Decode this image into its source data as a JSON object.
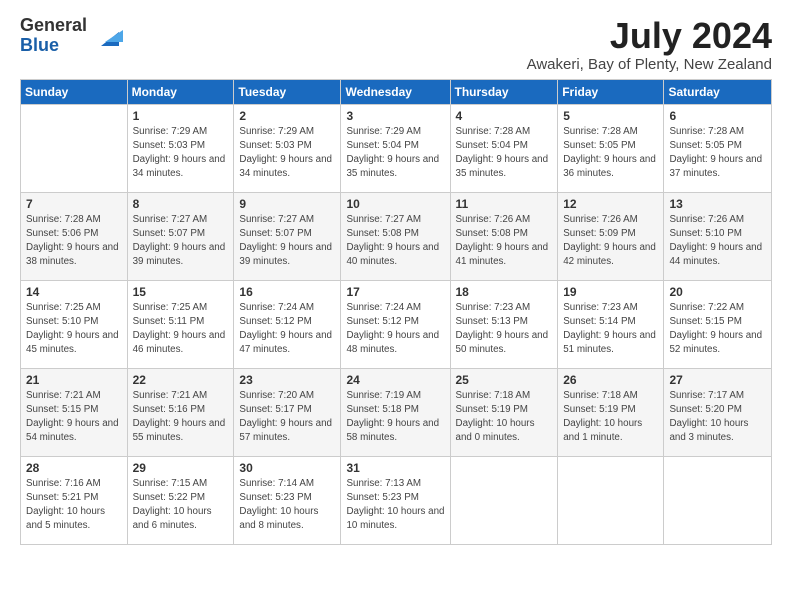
{
  "logo": {
    "general": "General",
    "blue": "Blue"
  },
  "title": "July 2024",
  "location": "Awakeri, Bay of Plenty, New Zealand",
  "weekdays": [
    "Sunday",
    "Monday",
    "Tuesday",
    "Wednesday",
    "Thursday",
    "Friday",
    "Saturday"
  ],
  "weeks": [
    [
      {
        "day": "",
        "sunrise": "",
        "sunset": "",
        "daylight": ""
      },
      {
        "day": "1",
        "sunrise": "Sunrise: 7:29 AM",
        "sunset": "Sunset: 5:03 PM",
        "daylight": "Daylight: 9 hours and 34 minutes."
      },
      {
        "day": "2",
        "sunrise": "Sunrise: 7:29 AM",
        "sunset": "Sunset: 5:03 PM",
        "daylight": "Daylight: 9 hours and 34 minutes."
      },
      {
        "day": "3",
        "sunrise": "Sunrise: 7:29 AM",
        "sunset": "Sunset: 5:04 PM",
        "daylight": "Daylight: 9 hours and 35 minutes."
      },
      {
        "day": "4",
        "sunrise": "Sunrise: 7:28 AM",
        "sunset": "Sunset: 5:04 PM",
        "daylight": "Daylight: 9 hours and 35 minutes."
      },
      {
        "day": "5",
        "sunrise": "Sunrise: 7:28 AM",
        "sunset": "Sunset: 5:05 PM",
        "daylight": "Daylight: 9 hours and 36 minutes."
      },
      {
        "day": "6",
        "sunrise": "Sunrise: 7:28 AM",
        "sunset": "Sunset: 5:05 PM",
        "daylight": "Daylight: 9 hours and 37 minutes."
      }
    ],
    [
      {
        "day": "7",
        "sunrise": "Sunrise: 7:28 AM",
        "sunset": "Sunset: 5:06 PM",
        "daylight": "Daylight: 9 hours and 38 minutes."
      },
      {
        "day": "8",
        "sunrise": "Sunrise: 7:27 AM",
        "sunset": "Sunset: 5:07 PM",
        "daylight": "Daylight: 9 hours and 39 minutes."
      },
      {
        "day": "9",
        "sunrise": "Sunrise: 7:27 AM",
        "sunset": "Sunset: 5:07 PM",
        "daylight": "Daylight: 9 hours and 39 minutes."
      },
      {
        "day": "10",
        "sunrise": "Sunrise: 7:27 AM",
        "sunset": "Sunset: 5:08 PM",
        "daylight": "Daylight: 9 hours and 40 minutes."
      },
      {
        "day": "11",
        "sunrise": "Sunrise: 7:26 AM",
        "sunset": "Sunset: 5:08 PM",
        "daylight": "Daylight: 9 hours and 41 minutes."
      },
      {
        "day": "12",
        "sunrise": "Sunrise: 7:26 AM",
        "sunset": "Sunset: 5:09 PM",
        "daylight": "Daylight: 9 hours and 42 minutes."
      },
      {
        "day": "13",
        "sunrise": "Sunrise: 7:26 AM",
        "sunset": "Sunset: 5:10 PM",
        "daylight": "Daylight: 9 hours and 44 minutes."
      }
    ],
    [
      {
        "day": "14",
        "sunrise": "Sunrise: 7:25 AM",
        "sunset": "Sunset: 5:10 PM",
        "daylight": "Daylight: 9 hours and 45 minutes."
      },
      {
        "day": "15",
        "sunrise": "Sunrise: 7:25 AM",
        "sunset": "Sunset: 5:11 PM",
        "daylight": "Daylight: 9 hours and 46 minutes."
      },
      {
        "day": "16",
        "sunrise": "Sunrise: 7:24 AM",
        "sunset": "Sunset: 5:12 PM",
        "daylight": "Daylight: 9 hours and 47 minutes."
      },
      {
        "day": "17",
        "sunrise": "Sunrise: 7:24 AM",
        "sunset": "Sunset: 5:12 PM",
        "daylight": "Daylight: 9 hours and 48 minutes."
      },
      {
        "day": "18",
        "sunrise": "Sunrise: 7:23 AM",
        "sunset": "Sunset: 5:13 PM",
        "daylight": "Daylight: 9 hours and 50 minutes."
      },
      {
        "day": "19",
        "sunrise": "Sunrise: 7:23 AM",
        "sunset": "Sunset: 5:14 PM",
        "daylight": "Daylight: 9 hours and 51 minutes."
      },
      {
        "day": "20",
        "sunrise": "Sunrise: 7:22 AM",
        "sunset": "Sunset: 5:15 PM",
        "daylight": "Daylight: 9 hours and 52 minutes."
      }
    ],
    [
      {
        "day": "21",
        "sunrise": "Sunrise: 7:21 AM",
        "sunset": "Sunset: 5:15 PM",
        "daylight": "Daylight: 9 hours and 54 minutes."
      },
      {
        "day": "22",
        "sunrise": "Sunrise: 7:21 AM",
        "sunset": "Sunset: 5:16 PM",
        "daylight": "Daylight: 9 hours and 55 minutes."
      },
      {
        "day": "23",
        "sunrise": "Sunrise: 7:20 AM",
        "sunset": "Sunset: 5:17 PM",
        "daylight": "Daylight: 9 hours and 57 minutes."
      },
      {
        "day": "24",
        "sunrise": "Sunrise: 7:19 AM",
        "sunset": "Sunset: 5:18 PM",
        "daylight": "Daylight: 9 hours and 58 minutes."
      },
      {
        "day": "25",
        "sunrise": "Sunrise: 7:18 AM",
        "sunset": "Sunset: 5:19 PM",
        "daylight": "Daylight: 10 hours and 0 minutes."
      },
      {
        "day": "26",
        "sunrise": "Sunrise: 7:18 AM",
        "sunset": "Sunset: 5:19 PM",
        "daylight": "Daylight: 10 hours and 1 minute."
      },
      {
        "day": "27",
        "sunrise": "Sunrise: 7:17 AM",
        "sunset": "Sunset: 5:20 PM",
        "daylight": "Daylight: 10 hours and 3 minutes."
      }
    ],
    [
      {
        "day": "28",
        "sunrise": "Sunrise: 7:16 AM",
        "sunset": "Sunset: 5:21 PM",
        "daylight": "Daylight: 10 hours and 5 minutes."
      },
      {
        "day": "29",
        "sunrise": "Sunrise: 7:15 AM",
        "sunset": "Sunset: 5:22 PM",
        "daylight": "Daylight: 10 hours and 6 minutes."
      },
      {
        "day": "30",
        "sunrise": "Sunrise: 7:14 AM",
        "sunset": "Sunset: 5:23 PM",
        "daylight": "Daylight: 10 hours and 8 minutes."
      },
      {
        "day": "31",
        "sunrise": "Sunrise: 7:13 AM",
        "sunset": "Sunset: 5:23 PM",
        "daylight": "Daylight: 10 hours and 10 minutes."
      },
      {
        "day": "",
        "sunrise": "",
        "sunset": "",
        "daylight": ""
      },
      {
        "day": "",
        "sunrise": "",
        "sunset": "",
        "daylight": ""
      },
      {
        "day": "",
        "sunrise": "",
        "sunset": "",
        "daylight": ""
      }
    ]
  ]
}
